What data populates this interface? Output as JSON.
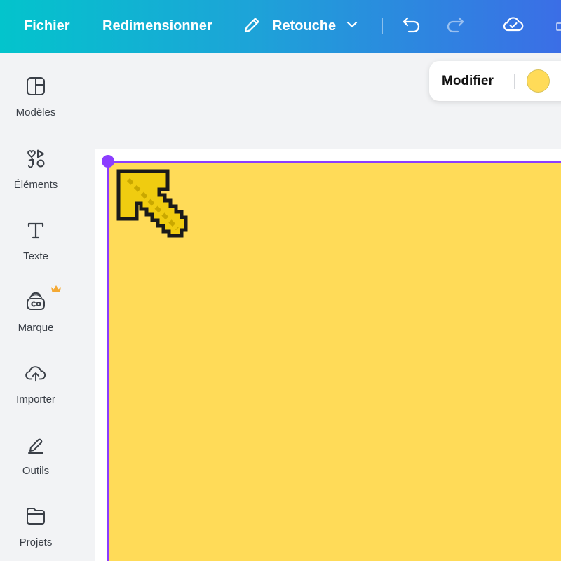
{
  "topbar": {
    "file_label": "Fichier",
    "resize_label": "Redimensionner",
    "edit_label": "Retouche"
  },
  "sidebar": {
    "items": [
      {
        "label": "Modèles",
        "icon": "templates-icon"
      },
      {
        "label": "Éléments",
        "icon": "elements-icon"
      },
      {
        "label": "Texte",
        "icon": "text-icon"
      },
      {
        "label": "Marque",
        "icon": "brand-icon"
      },
      {
        "label": "Importer",
        "icon": "upload-icon"
      },
      {
        "label": "Outils",
        "icon": "tools-icon"
      },
      {
        "label": "Projets",
        "icon": "folder-icon"
      }
    ]
  },
  "context_bar": {
    "edit_label": "Modifier",
    "swatch_color": "#ffdb58"
  },
  "canvas": {
    "background_color": "#ffdb58",
    "selection_color": "#8b3dff"
  },
  "colors": {
    "accent_gradient_start": "#03c4cc",
    "accent_gradient_end": "#3b6ee6",
    "arrow_fill": "#f0cc10",
    "arrow_outline": "#1a1a1a",
    "crown": "#f4a934"
  }
}
